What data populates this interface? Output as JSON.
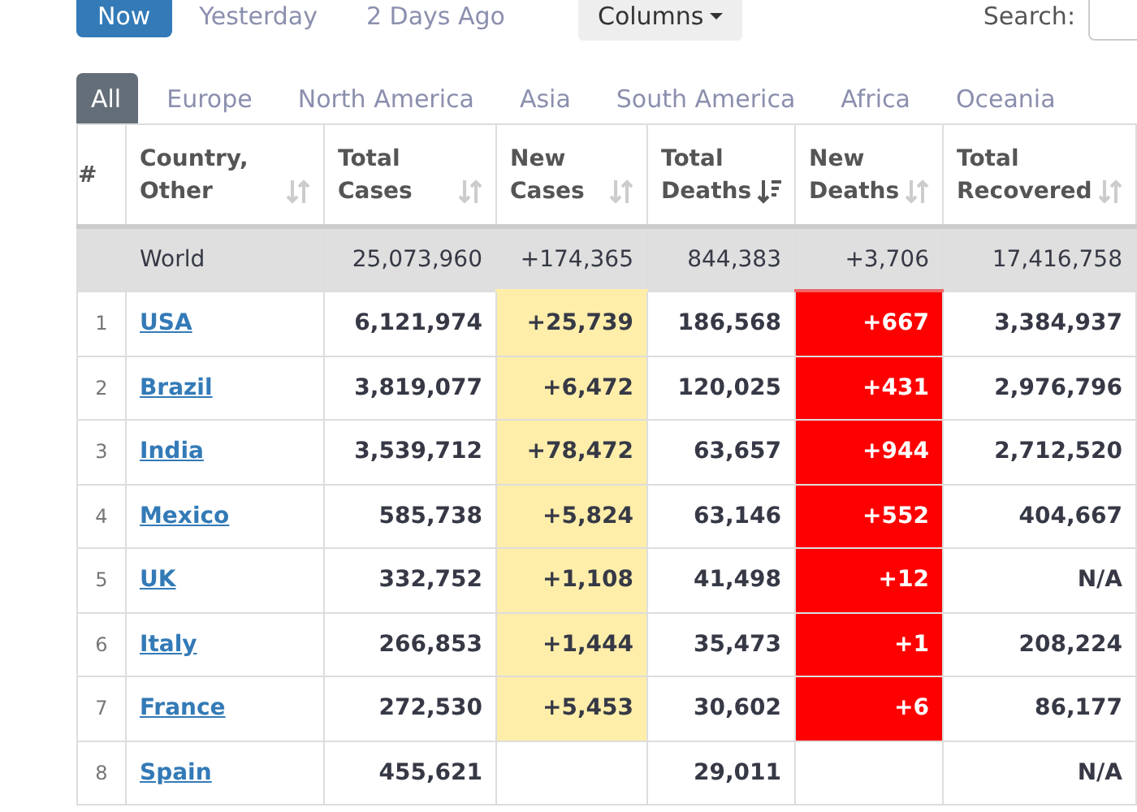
{
  "date_tabs": [
    {
      "label": "Now",
      "selected": true
    },
    {
      "label": "Yesterday",
      "selected": false
    },
    {
      "label": "2 Days Ago",
      "selected": false
    }
  ],
  "columns_button": {
    "label": "Columns"
  },
  "search": {
    "label": "Search:"
  },
  "region_tabs": [
    {
      "label": "All",
      "selected": true
    },
    {
      "label": "Europe",
      "selected": false
    },
    {
      "label": "North America",
      "selected": false
    },
    {
      "label": "Asia",
      "selected": false
    },
    {
      "label": "South America",
      "selected": false
    },
    {
      "label": "Africa",
      "selected": false
    },
    {
      "label": "Oceania",
      "selected": false
    }
  ],
  "table": {
    "columns": [
      {
        "label": "#",
        "kind": "rank"
      },
      {
        "label": "Country, Other",
        "kind": "country",
        "sorted": false
      },
      {
        "label": "Total Cases",
        "kind": "number",
        "sorted": false
      },
      {
        "label": "New Cases",
        "kind": "new_cases",
        "sorted": false
      },
      {
        "label": "Total Deaths",
        "kind": "number",
        "sorted": true
      },
      {
        "label": "New Deaths",
        "kind": "new_deaths",
        "sorted": false
      },
      {
        "label": "Total Recovered",
        "kind": "number",
        "sorted": false
      }
    ],
    "rows": [
      {
        "kind": "total",
        "cells": [
          "",
          "World",
          "25,073,960",
          "+174,365",
          "844,383",
          "+3,706",
          "17,416,758"
        ]
      },
      {
        "kind": "country",
        "cells": [
          "1",
          "USA",
          "6,121,974",
          "+25,739",
          "186,568",
          "+667",
          "3,384,937"
        ]
      },
      {
        "kind": "country",
        "cells": [
          "2",
          "Brazil",
          "3,819,077",
          "+6,472",
          "120,025",
          "+431",
          "2,976,796"
        ]
      },
      {
        "kind": "country",
        "cells": [
          "3",
          "India",
          "3,539,712",
          "+78,472",
          "63,657",
          "+944",
          "2,712,520"
        ]
      },
      {
        "kind": "country",
        "cells": [
          "4",
          "Mexico",
          "585,738",
          "+5,824",
          "63,146",
          "+552",
          "404,667"
        ]
      },
      {
        "kind": "country",
        "cells": [
          "5",
          "UK",
          "332,752",
          "+1,108",
          "41,498",
          "+12",
          "N/A"
        ]
      },
      {
        "kind": "country",
        "cells": [
          "6",
          "Italy",
          "266,853",
          "+1,444",
          "35,473",
          "+1",
          "208,224"
        ]
      },
      {
        "kind": "country",
        "cells": [
          "7",
          "France",
          "272,530",
          "+5,453",
          "30,602",
          "+6",
          "86,177"
        ]
      },
      {
        "kind": "country",
        "cells": [
          "8",
          "Spain",
          "455,621",
          "",
          "29,011",
          "",
          "N/A"
        ]
      }
    ]
  }
}
